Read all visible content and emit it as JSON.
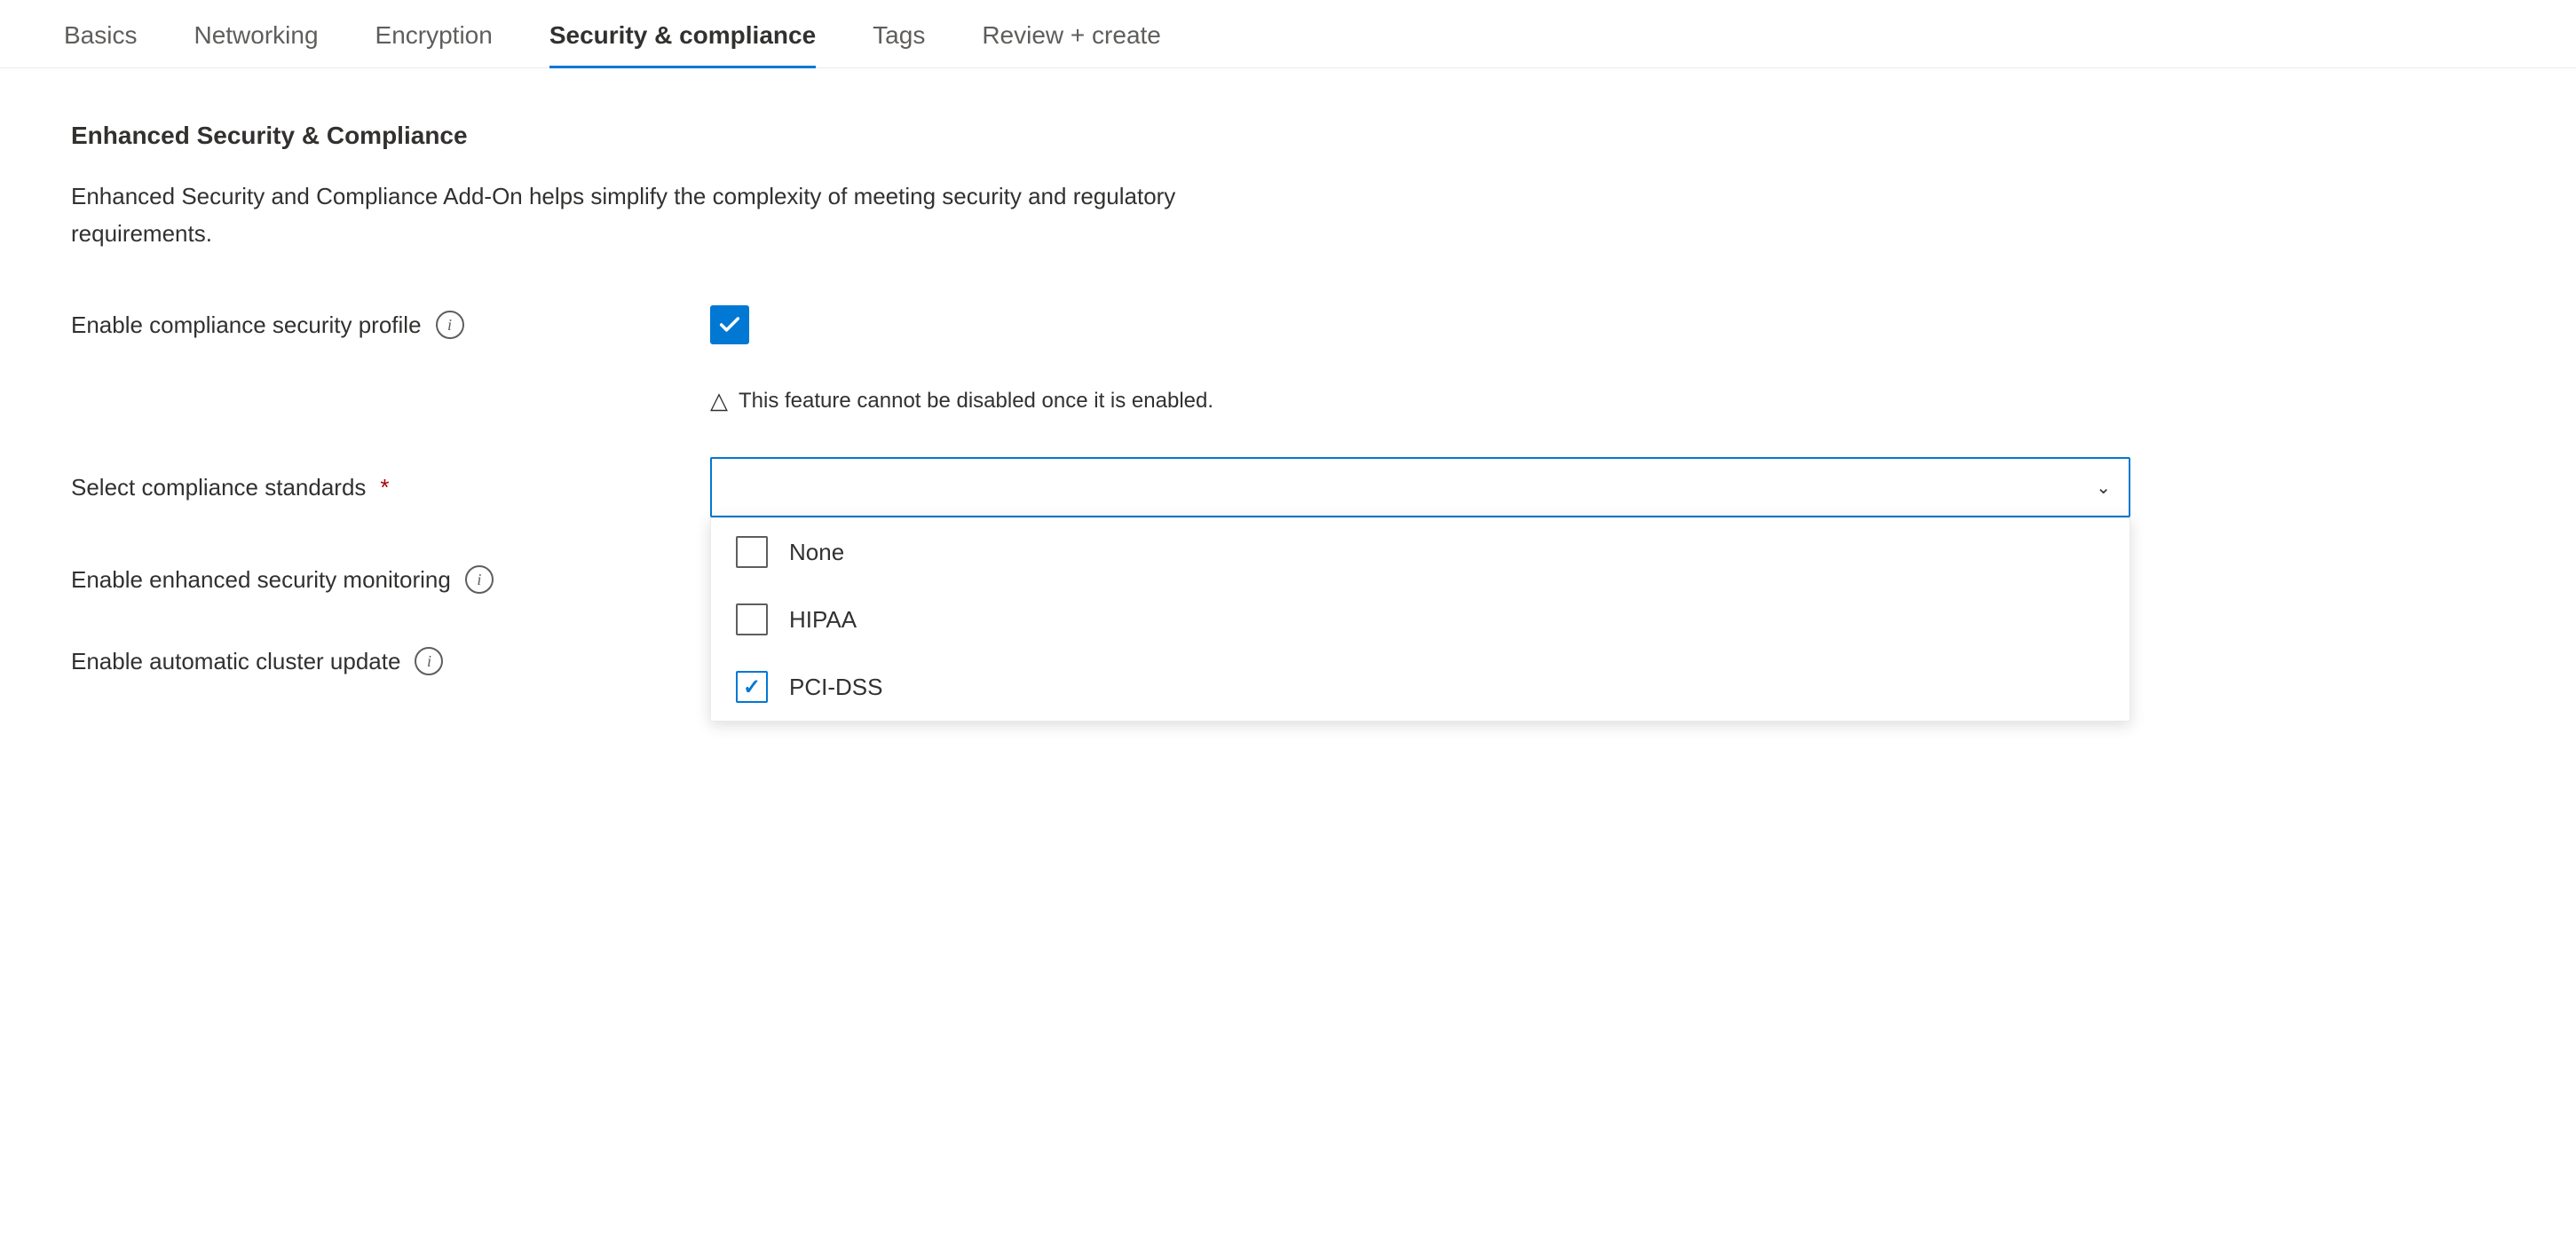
{
  "tabs": [
    {
      "id": "basics",
      "label": "Basics",
      "active": false
    },
    {
      "id": "networking",
      "label": "Networking",
      "active": false
    },
    {
      "id": "encryption",
      "label": "Encryption",
      "active": false
    },
    {
      "id": "security",
      "label": "Security & compliance",
      "active": true
    },
    {
      "id": "tags",
      "label": "Tags",
      "active": false
    },
    {
      "id": "review",
      "label": "Review + create",
      "active": false
    }
  ],
  "section": {
    "title": "Enhanced Security & Compliance",
    "description": "Enhanced Security and Compliance Add-On helps simplify the complexity of meeting security and regulatory requirements."
  },
  "form": {
    "compliance_profile_label": "Enable compliance security profile",
    "compliance_profile_checked": true,
    "warning_icon": "△",
    "warning_text": "This feature cannot be disabled once it is enabled.",
    "compliance_standards_label": "Select compliance standards",
    "compliance_standards_required": true,
    "security_monitoring_label": "Enable enhanced security monitoring",
    "cluster_update_label": "Enable automatic cluster update"
  },
  "dropdown": {
    "options": [
      {
        "id": "none",
        "label": "None",
        "checked": false
      },
      {
        "id": "hipaa",
        "label": "HIPAA",
        "checked": false
      },
      {
        "id": "pci-dss",
        "label": "PCI-DSS",
        "checked": true
      }
    ]
  },
  "icons": {
    "info": "i",
    "chevron_down": "⌄",
    "check": "✓"
  }
}
